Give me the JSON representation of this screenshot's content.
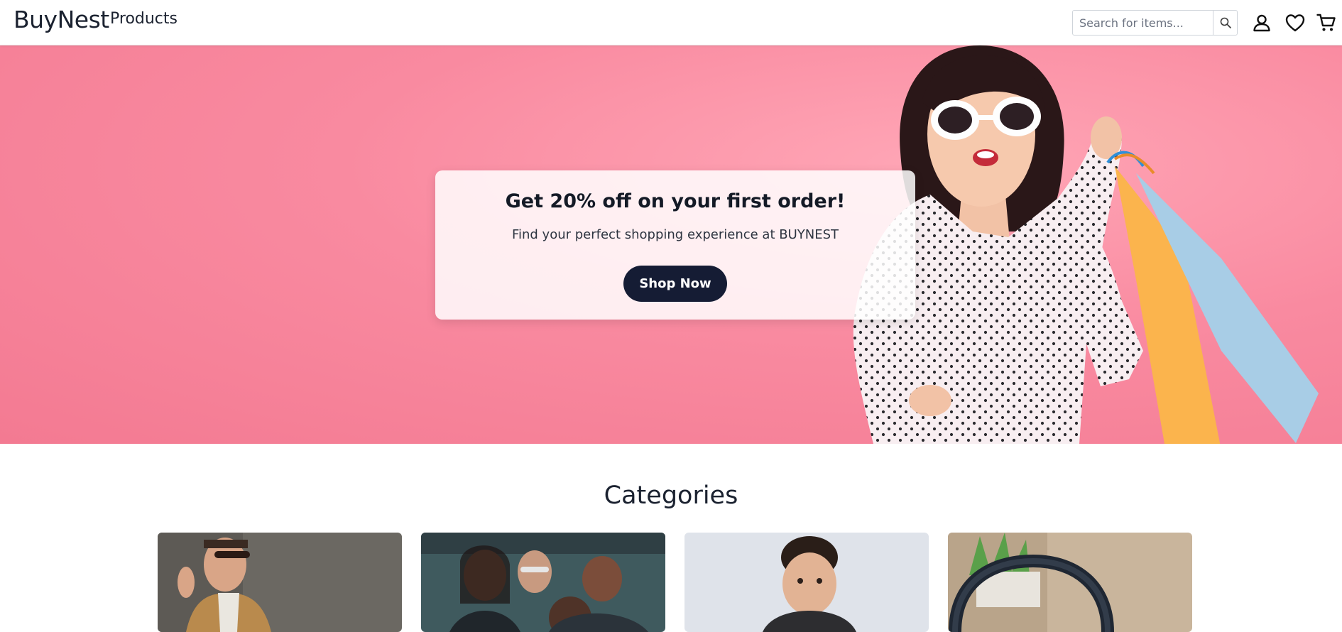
{
  "header": {
    "logo": "BuyNest",
    "nav_products": "Products",
    "search_placeholder": "Search for items..."
  },
  "icons": {
    "search": "search-icon",
    "account": "user-icon",
    "wishlist": "heart-icon",
    "cart": "cart-icon"
  },
  "hero": {
    "title": "Get 20% off on your first order!",
    "subtitle": "Find your perfect shopping experience at BUYNEST",
    "cta": "Shop Now"
  },
  "categories": {
    "heading": "Categories"
  },
  "colors": {
    "hero_bg": "#f98aa0",
    "cta_bg": "#151c34",
    "text_dark": "#1b2230"
  }
}
